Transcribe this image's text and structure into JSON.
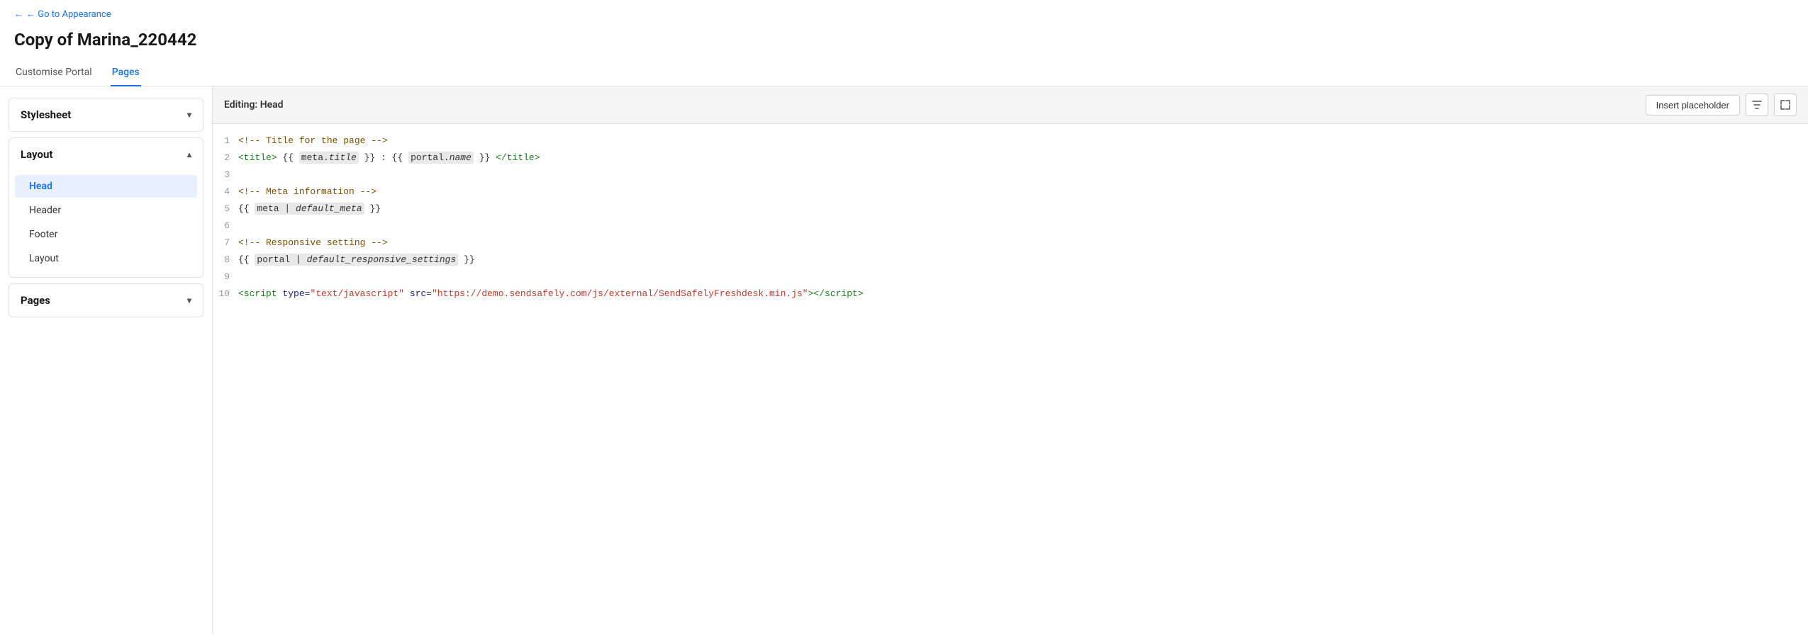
{
  "backLink": {
    "label": "← Go to Appearance",
    "href": "#"
  },
  "pageTitle": "Copy of Marina_220442",
  "tabs": [
    {
      "id": "customise-portal",
      "label": "Customise Portal",
      "active": false
    },
    {
      "id": "pages",
      "label": "Pages",
      "active": true
    }
  ],
  "sidebar": {
    "sections": [
      {
        "id": "stylesheet",
        "title": "Stylesheet",
        "expanded": false,
        "items": []
      },
      {
        "id": "layout",
        "title": "Layout",
        "expanded": true,
        "items": [
          {
            "id": "head",
            "label": "Head",
            "active": true
          },
          {
            "id": "header",
            "label": "Header",
            "active": false
          },
          {
            "id": "footer",
            "label": "Footer",
            "active": false
          },
          {
            "id": "layout",
            "label": "Layout",
            "active": false
          }
        ]
      },
      {
        "id": "pages",
        "title": "Pages",
        "expanded": false,
        "items": []
      }
    ]
  },
  "editor": {
    "editingLabel": "Editing: Head",
    "insertPlaceholderBtn": "Insert placeholder",
    "filterIconTitle": "Filter",
    "expandIconTitle": "Expand",
    "lines": [
      {
        "num": 1,
        "type": "comment",
        "text": "<!-- Title for the page -->"
      },
      {
        "num": 2,
        "type": "code",
        "text": "<title> {{ meta.title }} : {{ portal.name }} </title>"
      },
      {
        "num": 3,
        "type": "empty",
        "text": ""
      },
      {
        "num": 4,
        "type": "comment",
        "text": "<!-- Meta information -->"
      },
      {
        "num": 5,
        "type": "code",
        "text": "{{ meta | default_meta }}"
      },
      {
        "num": 6,
        "type": "empty",
        "text": ""
      },
      {
        "num": 7,
        "type": "comment",
        "text": "<!-- Responsive setting -->"
      },
      {
        "num": 8,
        "type": "code",
        "text": "{{ portal | default_responsive_settings }}"
      },
      {
        "num": 9,
        "type": "empty",
        "text": ""
      },
      {
        "num": 10,
        "type": "script",
        "text": "<script type=\"text/javascript\" src=\"https://demo.sendsafely.com/js/external/SendSafelyFreshdesk.min.js\"><\\/script>"
      }
    ]
  }
}
